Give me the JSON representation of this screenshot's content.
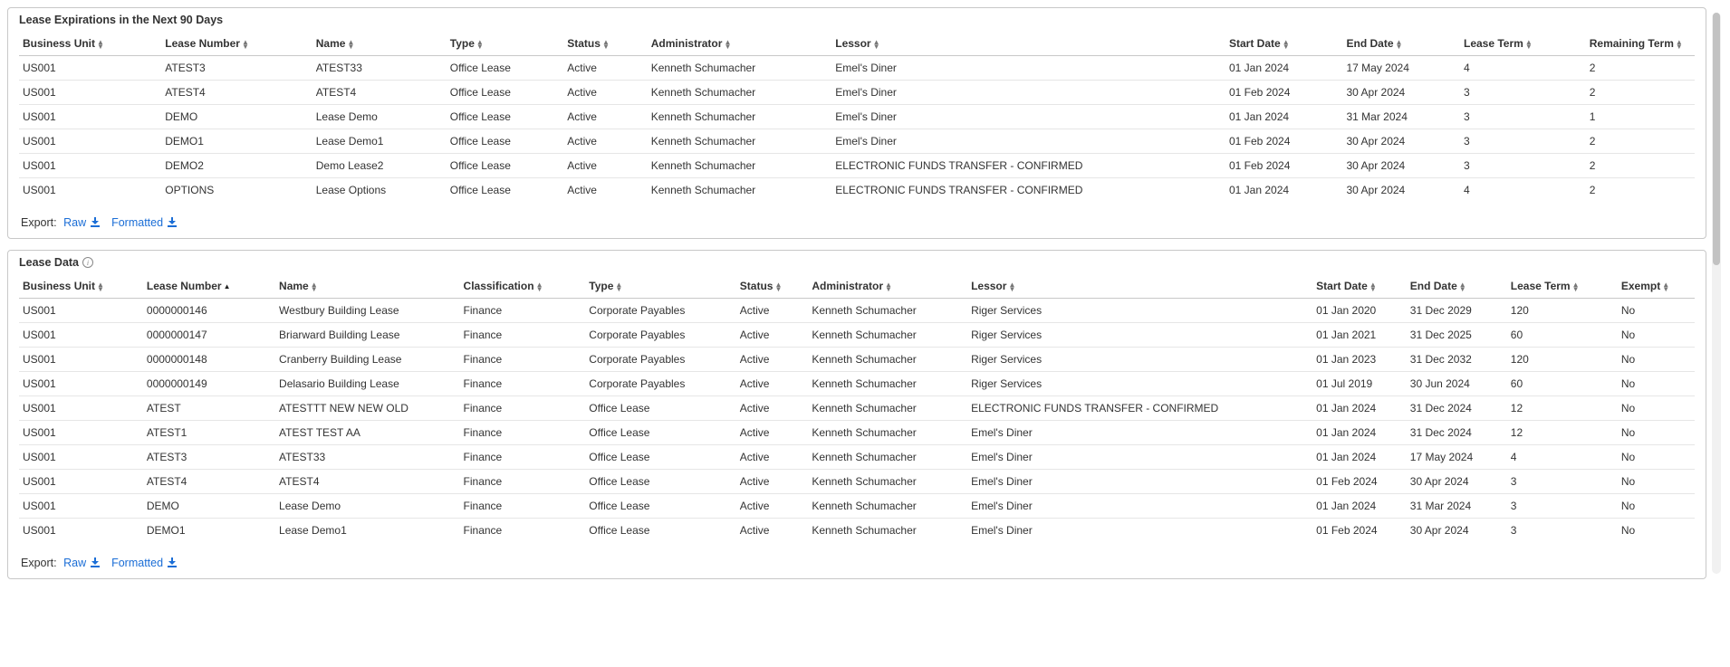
{
  "export": {
    "label": "Export:",
    "raw": "Raw",
    "formatted": "Formatted"
  },
  "expirations": {
    "title": "Lease Expirations in the Next 90 Days",
    "columns": [
      "Business Unit",
      "Lease Number",
      "Name",
      "Type",
      "Status",
      "Administrator",
      "Lessor",
      "Start Date",
      "End Date",
      "Lease Term",
      "Remaining Term"
    ],
    "rows": [
      [
        "US001",
        "ATEST3",
        "ATEST33",
        "Office Lease",
        "Active",
        "Kenneth Schumacher",
        "Emel's Diner",
        "01 Jan 2024",
        "17 May 2024",
        "4",
        "2"
      ],
      [
        "US001",
        "ATEST4",
        "ATEST4",
        "Office Lease",
        "Active",
        "Kenneth Schumacher",
        "Emel's Diner",
        "01 Feb 2024",
        "30 Apr 2024",
        "3",
        "2"
      ],
      [
        "US001",
        "DEMO",
        "Lease Demo",
        "Office Lease",
        "Active",
        "Kenneth Schumacher",
        "Emel's Diner",
        "01 Jan 2024",
        "31 Mar 2024",
        "3",
        "1"
      ],
      [
        "US001",
        "DEMO1",
        "Lease Demo1",
        "Office Lease",
        "Active",
        "Kenneth Schumacher",
        "Emel's Diner",
        "01 Feb 2024",
        "30 Apr 2024",
        "3",
        "2"
      ],
      [
        "US001",
        "DEMO2",
        "Demo Lease2",
        "Office Lease",
        "Active",
        "Kenneth Schumacher",
        "ELECTRONIC FUNDS TRANSFER - CONFIRMED",
        "01 Feb 2024",
        "30 Apr 2024",
        "3",
        "2"
      ],
      [
        "US001",
        "OPTIONS",
        "Lease Options",
        "Office Lease",
        "Active",
        "Kenneth Schumacher",
        "ELECTRONIC FUNDS TRANSFER - CONFIRMED",
        "01 Jan 2024",
        "30 Apr 2024",
        "4",
        "2"
      ]
    ]
  },
  "leasedata": {
    "title": "Lease Data",
    "columns": [
      "Business Unit",
      "Lease Number",
      "Name",
      "Classification",
      "Type",
      "Status",
      "Administrator",
      "Lessor",
      "Start Date",
      "End Date",
      "Lease Term",
      "Exempt"
    ],
    "sort_asc_col": 1,
    "rows": [
      [
        "US001",
        "0000000146",
        "Westbury Building Lease",
        "Finance",
        "Corporate Payables",
        "Active",
        "Kenneth Schumacher",
        "Riger Services",
        "01 Jan 2020",
        "31 Dec 2029",
        "120",
        "No"
      ],
      [
        "US001",
        "0000000147",
        "Briarward Building Lease",
        "Finance",
        "Corporate Payables",
        "Active",
        "Kenneth Schumacher",
        "Riger Services",
        "01 Jan 2021",
        "31 Dec 2025",
        "60",
        "No"
      ],
      [
        "US001",
        "0000000148",
        "Cranberry Building Lease",
        "Finance",
        "Corporate Payables",
        "Active",
        "Kenneth Schumacher",
        "Riger Services",
        "01 Jan 2023",
        "31 Dec 2032",
        "120",
        "No"
      ],
      [
        "US001",
        "0000000149",
        "Delasario Building Lease",
        "Finance",
        "Corporate Payables",
        "Active",
        "Kenneth Schumacher",
        "Riger Services",
        "01 Jul 2019",
        "30 Jun 2024",
        "60",
        "No"
      ],
      [
        "US001",
        "ATEST",
        "ATESTTT NEW NEW OLD",
        "Finance",
        "Office Lease",
        "Active",
        "Kenneth Schumacher",
        "ELECTRONIC FUNDS TRANSFER - CONFIRMED",
        "01 Jan 2024",
        "31 Dec 2024",
        "12",
        "No"
      ],
      [
        "US001",
        "ATEST1",
        "ATEST TEST AA",
        "Finance",
        "Office Lease",
        "Active",
        "Kenneth Schumacher",
        "Emel's Diner",
        "01 Jan 2024",
        "31 Dec 2024",
        "12",
        "No"
      ],
      [
        "US001",
        "ATEST3",
        "ATEST33",
        "Finance",
        "Office Lease",
        "Active",
        "Kenneth Schumacher",
        "Emel's Diner",
        "01 Jan 2024",
        "17 May 2024",
        "4",
        "No"
      ],
      [
        "US001",
        "ATEST4",
        "ATEST4",
        "Finance",
        "Office Lease",
        "Active",
        "Kenneth Schumacher",
        "Emel's Diner",
        "01 Feb 2024",
        "30 Apr 2024",
        "3",
        "No"
      ],
      [
        "US001",
        "DEMO",
        "Lease Demo",
        "Finance",
        "Office Lease",
        "Active",
        "Kenneth Schumacher",
        "Emel's Diner",
        "01 Jan 2024",
        "31 Mar 2024",
        "3",
        "No"
      ],
      [
        "US001",
        "DEMO1",
        "Lease Demo1",
        "Finance",
        "Office Lease",
        "Active",
        "Kenneth Schumacher",
        "Emel's Diner",
        "01 Feb 2024",
        "30 Apr 2024",
        "3",
        "No"
      ]
    ]
  }
}
